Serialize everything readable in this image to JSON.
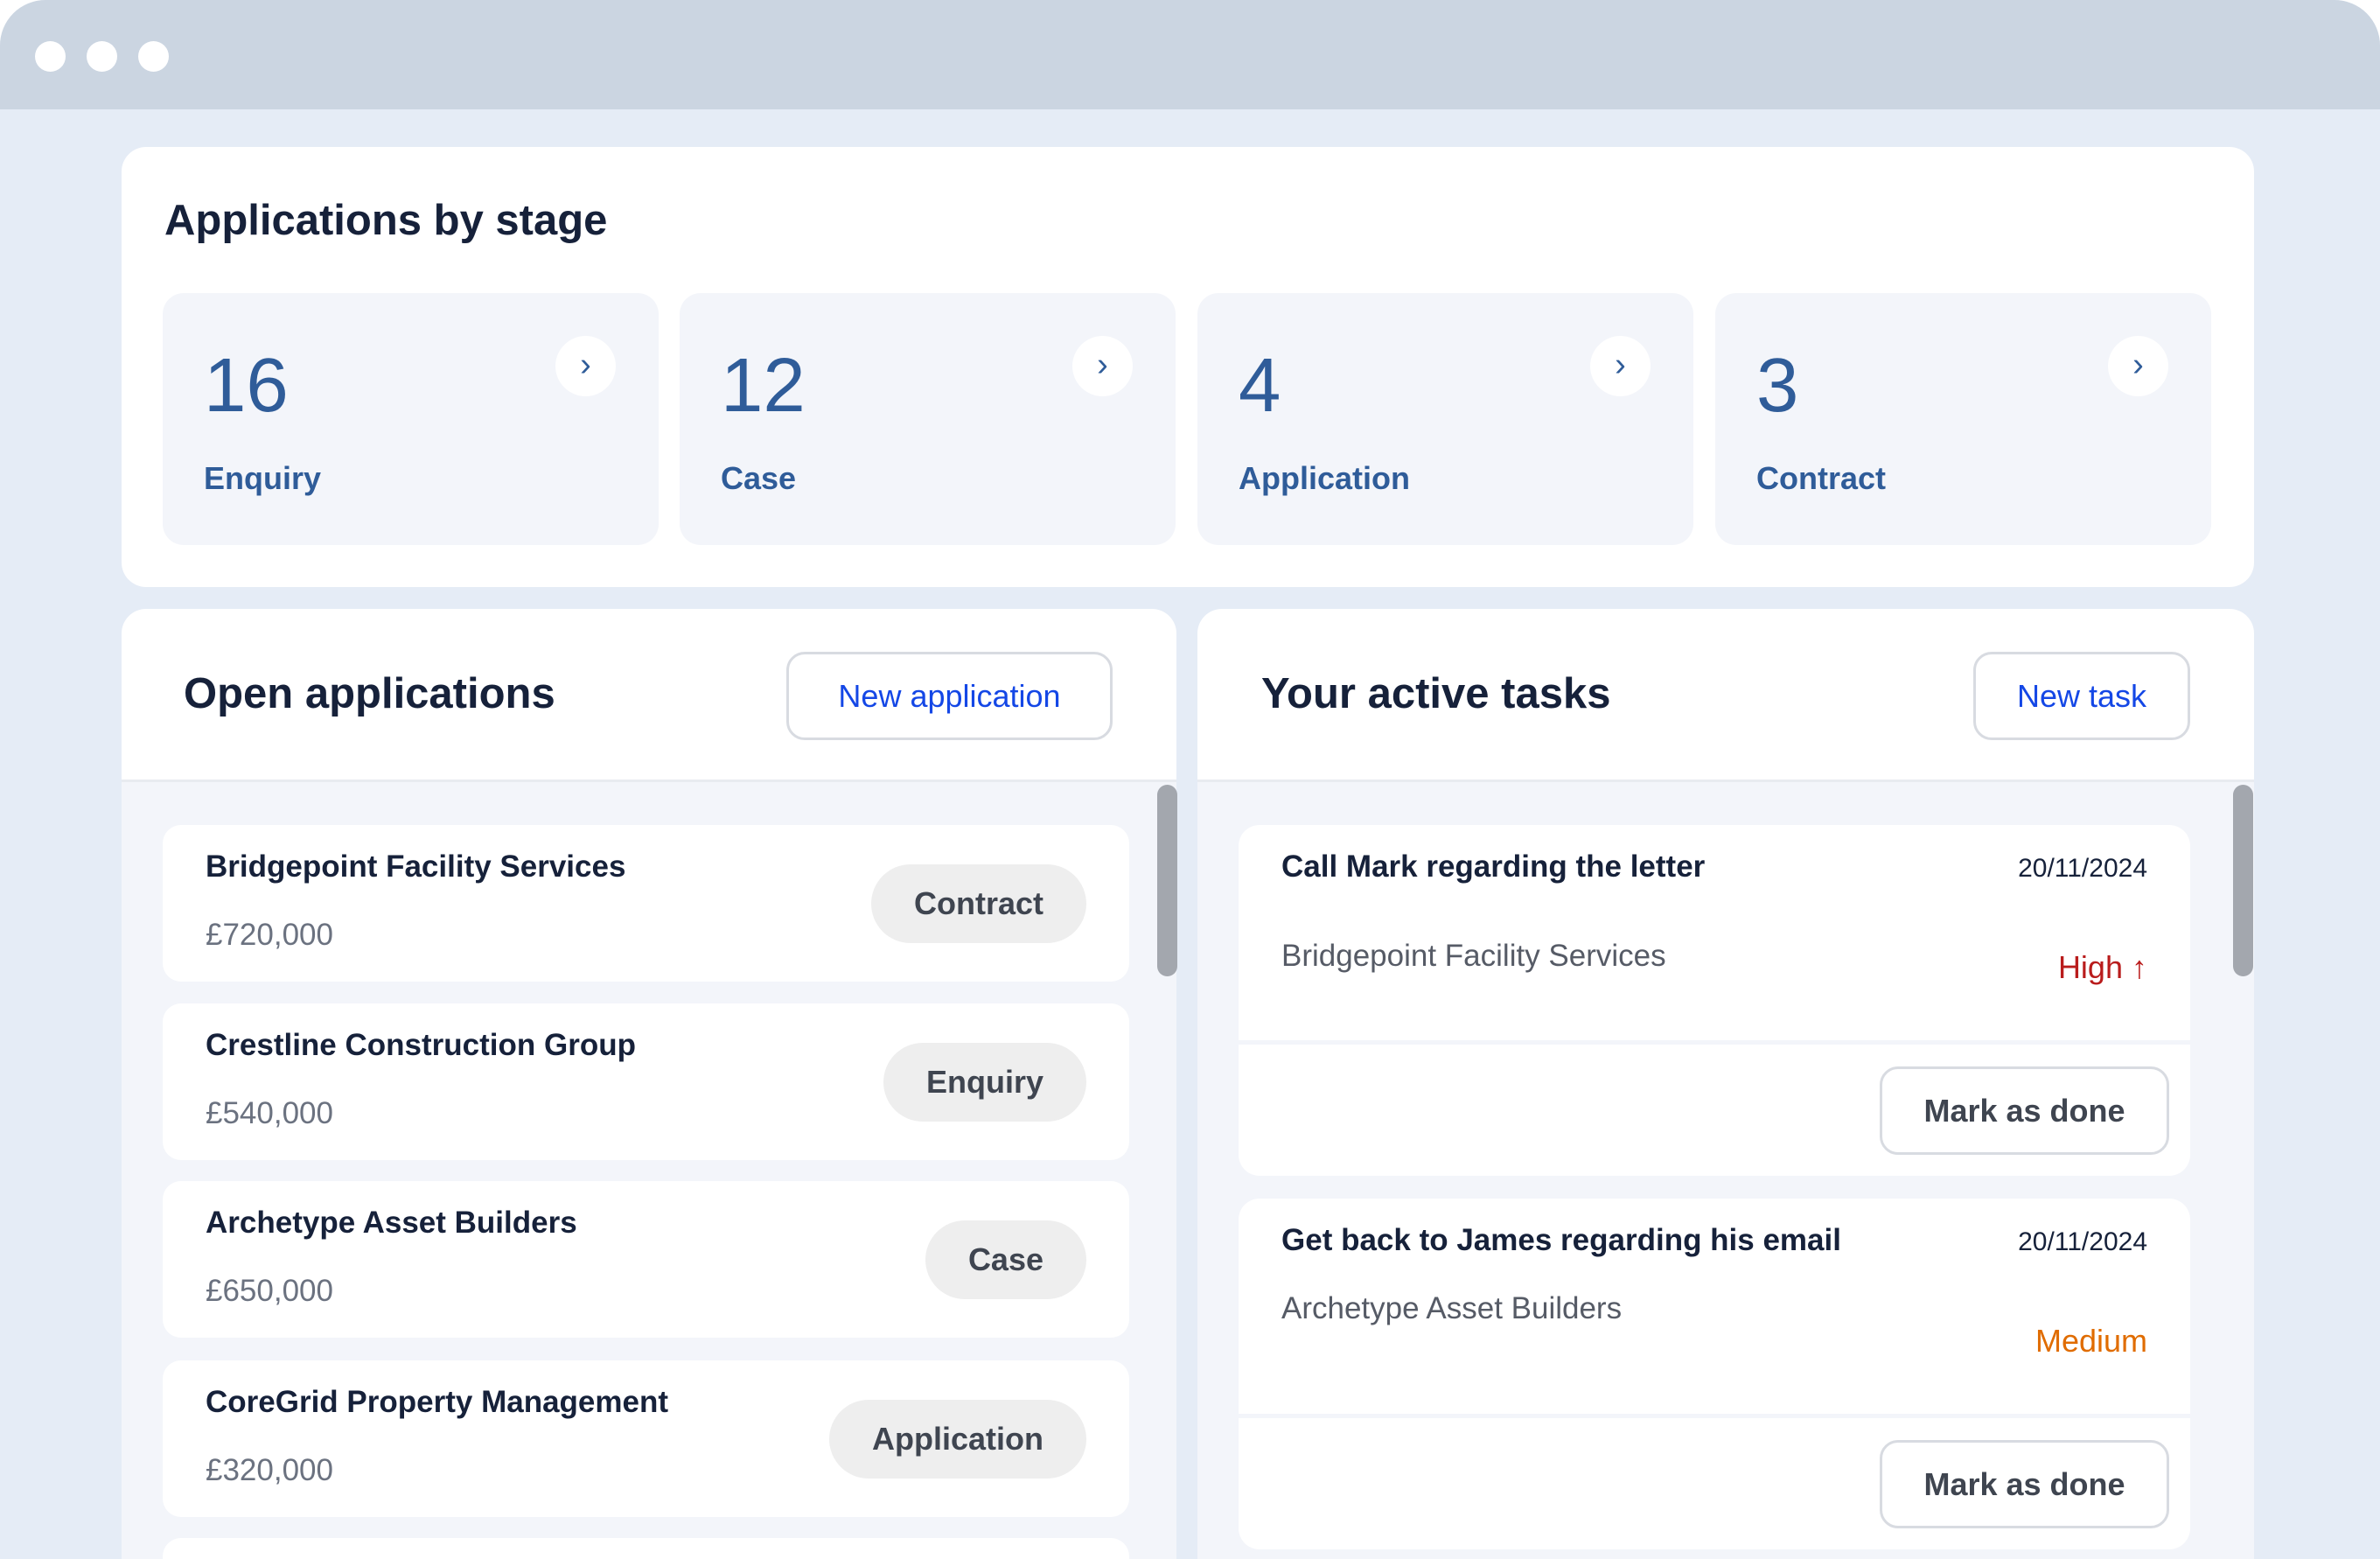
{
  "stages": {
    "title": "Applications by stage",
    "items": [
      {
        "count": "16",
        "label": "Enquiry"
      },
      {
        "count": "12",
        "label": "Case"
      },
      {
        "count": "4",
        "label": "Application"
      },
      {
        "count": "3",
        "label": "Contract"
      }
    ]
  },
  "applications": {
    "title": "Open applications",
    "new_label": "New application",
    "items": [
      {
        "name": "Bridgepoint Facility Services",
        "amount": "£720,000",
        "stage": "Contract"
      },
      {
        "name": "Crestline Construction Group",
        "amount": "£540,000",
        "stage": "Enquiry"
      },
      {
        "name": "Archetype Asset Builders",
        "amount": "£650,000",
        "stage": "Case"
      },
      {
        "name": "CoreGrid Property Management",
        "amount": "£320,000",
        "stage": "Application"
      }
    ]
  },
  "tasks": {
    "title": "Your active tasks",
    "new_label": "New task",
    "items": [
      {
        "title": "Call Mark regarding the letter",
        "date": "20/11/2024",
        "company": "Bridgepoint Facility Services",
        "priority": "High",
        "priority_color": "#b91c1c",
        "action": "Mark as done"
      },
      {
        "title": "Get back to James regarding his email",
        "date": "20/11/2024",
        "company": "Archetype Asset Builders",
        "priority": "Medium",
        "priority_color": "#e06c00",
        "action": "Mark as done"
      }
    ]
  }
}
